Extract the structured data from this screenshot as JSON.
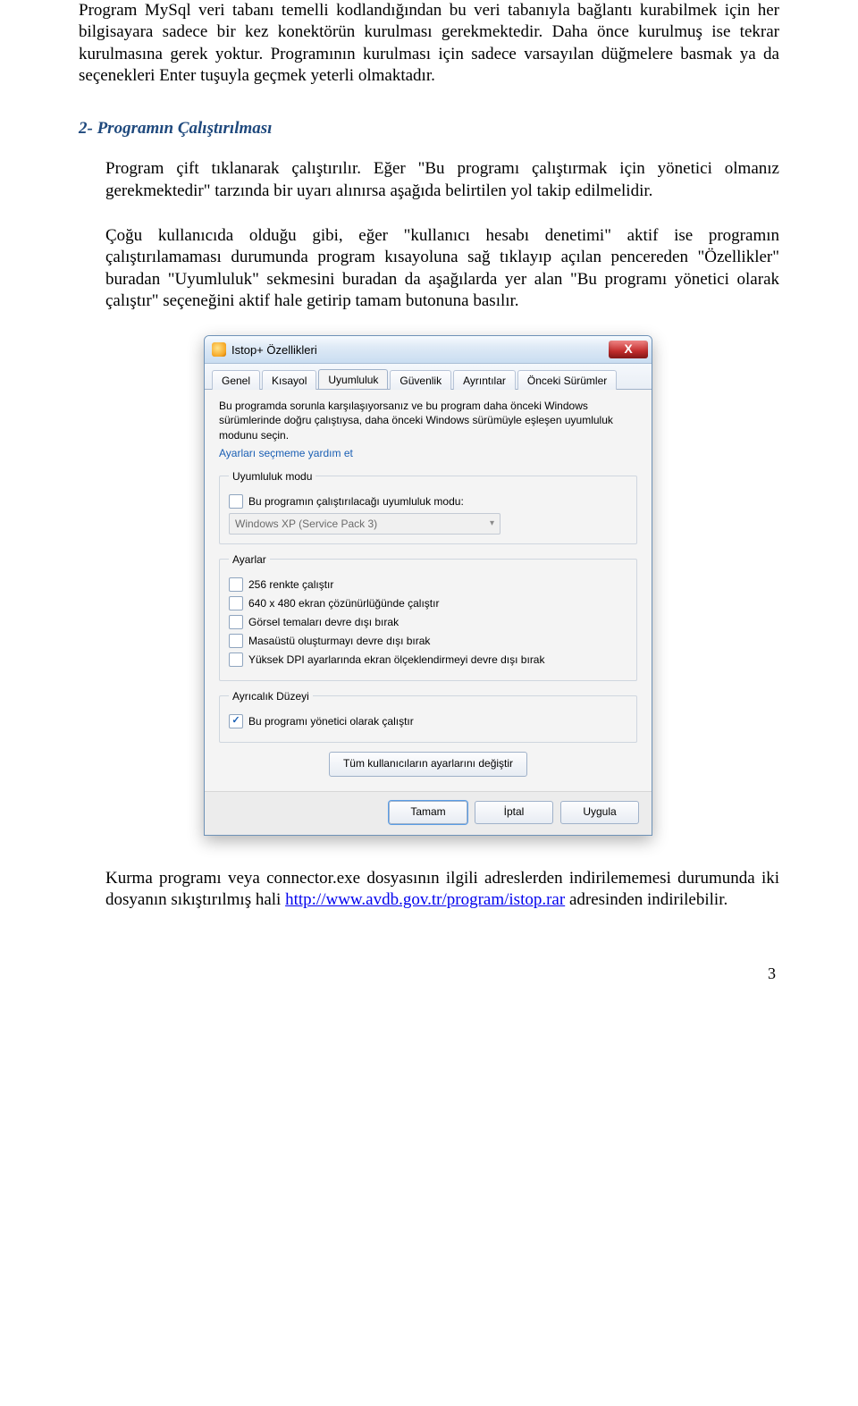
{
  "paragraphs": {
    "p1": "Program MySql veri tabanı temelli kodlandığından bu veri tabanıyla bağlantı kurabilmek için her bilgisayara sadece bir kez konektörün kurulması gerekmektedir. Daha önce kurulmuş ise tekrar kurulmasına gerek yoktur. Programının kurulması için sadece varsayılan düğmelere basmak ya da seçenekleri Enter tuşuyla geçmek yeterli olmaktadır.",
    "heading2": "2-  Programın Çalıştırılması",
    "p2": "Program çift tıklanarak çalıştırılır. Eğer \"Bu programı çalıştırmak için yönetici olmanız gerekmektedir\" tarzında bir uyarı alınırsa aşağıda belirtilen yol takip edilmelidir.",
    "p3": "Çoğu kullanıcıda olduğu gibi, eğer \"kullanıcı hesabı denetimi\" aktif ise programın çalıştırılamaması durumunda program kısayoluna sağ tıklayıp açılan pencereden \"Özellikler\" buradan \"Uyumluluk\" sekmesini buradan da aşağılarda yer alan \"Bu programı yönetici olarak çalıştır\" seçeneğini aktif hale getirip tamam butonuna basılır.",
    "p4a": "Kurma programı veya connector.exe dosyasının ilgili adreslerden indirilememesi durumunda iki dosyanın sıkıştırılmış hali ",
    "p4_link_text": "http://www.avdb.gov.tr/program/istop.rar",
    "p4_link_href": "http://www.avdb.gov.tr/program/istop.rar",
    "p4b": " adresinden indirilebilir."
  },
  "dialog": {
    "title": "Istop+ Özellikleri",
    "close_label": "X",
    "tabs": [
      "Genel",
      "Kısayol",
      "Uyumluluk",
      "Güvenlik",
      "Ayrıntılar",
      "Önceki Sürümler"
    ],
    "intro": "Bu programda sorunla karşılaşıyorsanız ve bu program daha önceki Windows sürümlerinde doğru çalıştıysa, daha önceki Windows sürümüyle eşleşen uyumluluk modunu seçin.",
    "help_link": "Ayarları seçmeme yardım et",
    "group_compat": {
      "legend": "Uyumluluk modu",
      "chk_label": "Bu programın çalıştırılacağı uyumluluk modu:",
      "combo_value": "Windows XP (Service Pack 3)"
    },
    "group_settings": {
      "legend": "Ayarlar",
      "items": [
        "256 renkte çalıştır",
        "640 x 480 ekran çözünürlüğünde çalıştır",
        "Görsel temaları devre dışı bırak",
        "Masaüstü oluşturmayı devre dışı bırak",
        "Yüksek DPI ayarlarında ekran ölçeklendirmeyi devre dışı bırak"
      ]
    },
    "group_priv": {
      "legend": "Ayrıcalık Düzeyi",
      "chk_label": "Bu programı yönetici olarak çalıştır"
    },
    "all_users_btn": "Tüm kullanıcıların ayarlarını değiştir",
    "buttons": {
      "ok": "Tamam",
      "cancel": "İptal",
      "apply": "Uygula"
    }
  },
  "page_number": "3"
}
